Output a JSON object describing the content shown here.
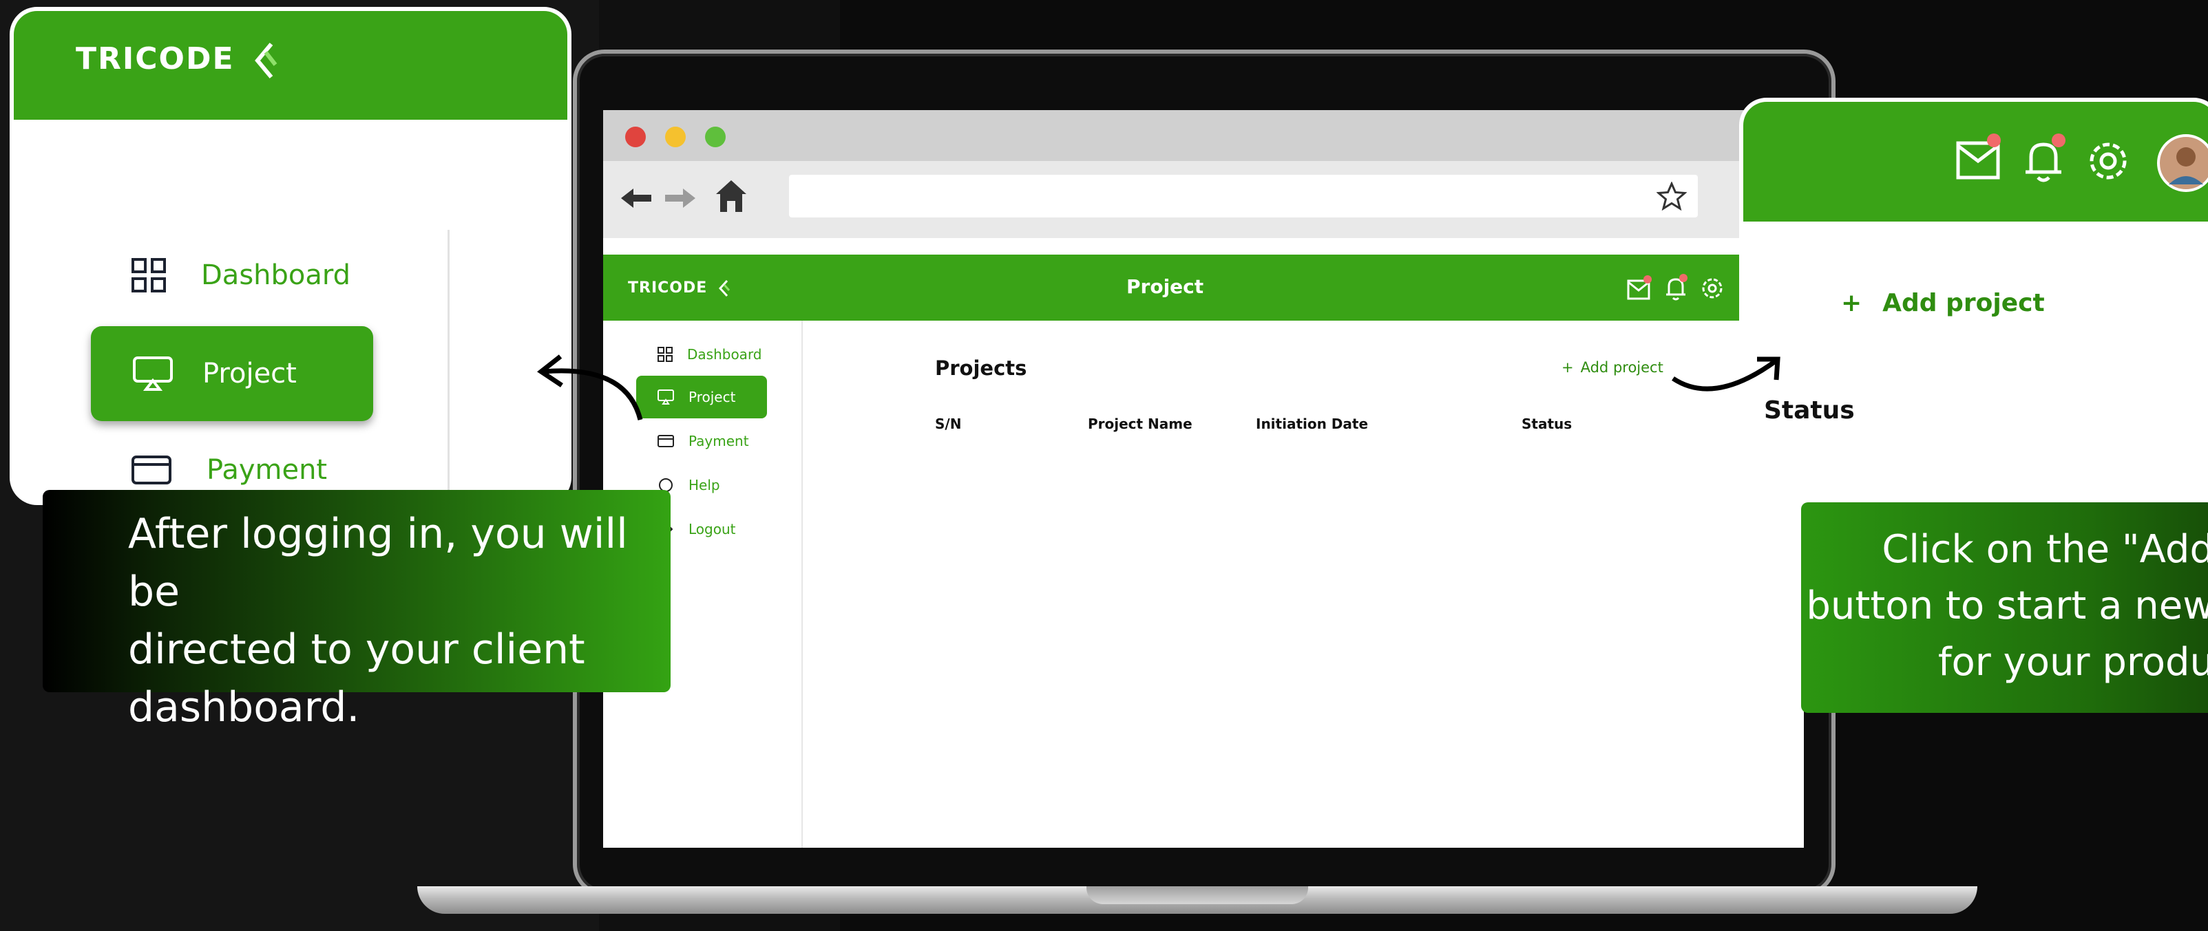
{
  "colors": {
    "brand_green": "#3aa317",
    "link_green": "#2f8d10",
    "background": "#0b0b0b",
    "notification_dot": "#f06a6a"
  },
  "brand": {
    "logo_text": "TRICODE"
  },
  "browser": {
    "window_controls": [
      "close-dot-red",
      "minimize-dot-yellow",
      "maximize-dot-green"
    ],
    "nav_icons": [
      "back-arrow-icon",
      "forward-arrow-icon",
      "home-icon",
      "bookmark-star-icon"
    ]
  },
  "app": {
    "header_title": "Project",
    "header_icons": [
      "mail-icon",
      "bell-icon",
      "gear-icon"
    ],
    "sidebar": [
      {
        "label": "Dashboard",
        "icon": "grid-icon",
        "active": false
      },
      {
        "label": "Project",
        "icon": "project-monitor-icon",
        "active": true
      },
      {
        "label": "Payment",
        "icon": "card-icon",
        "active": false
      },
      {
        "label": "Help",
        "icon": "help-icon",
        "active": false
      },
      {
        "label": "Logout",
        "icon": "logout-icon",
        "active": false
      }
    ],
    "content": {
      "title": "Projects",
      "add_button": "Add project",
      "add_icon": "+",
      "columns": [
        "S/N",
        "Project Name",
        "Initiation Date",
        "Status"
      ]
    }
  },
  "zoom_left": {
    "items": [
      "Dashboard",
      "Project",
      "Payment"
    ]
  },
  "zoom_right": {
    "add_button": "Add project",
    "add_icon": "+",
    "status_label": "Status",
    "icons": [
      "mail-icon",
      "bell-icon",
      "gear-icon",
      "avatar"
    ]
  },
  "captions": {
    "left": {
      "line1": "After logging in, you will be",
      "line2": "directed to your client",
      "line3": "dashboard."
    },
    "right": {
      "line1": "Click on the \"Add",
      "line2": "button to start a new",
      "line3": "for your produ"
    }
  }
}
